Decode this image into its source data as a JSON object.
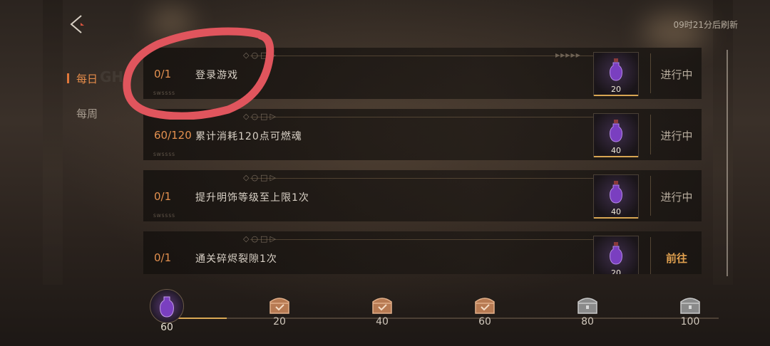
{
  "header": {
    "refresh_text": "09时21分后刷新"
  },
  "tabs": [
    {
      "label": "每日",
      "active": true
    },
    {
      "label": "每周",
      "active": false
    }
  ],
  "tasks": [
    {
      "progress": "0/1",
      "name": "登录游戏",
      "reward": "20",
      "status": "进行中"
    },
    {
      "progress": "60/120",
      "name": "累计消耗120点可燃魂",
      "reward": "40",
      "status": "进行中"
    },
    {
      "progress": "0/1",
      "name": "提升明饰等级至上限1次",
      "reward": "40",
      "status": "进行中"
    },
    {
      "progress": "0/1",
      "name": "通关碎烬裂隙1次",
      "reward": "20",
      "status": "前往"
    }
  ],
  "activity": {
    "current": "60",
    "milestones": [
      {
        "value": "20",
        "state": "claimed"
      },
      {
        "value": "40",
        "state": "claimed"
      },
      {
        "value": "60",
        "state": "claimed"
      },
      {
        "value": "80",
        "state": "locked"
      },
      {
        "value": "100",
        "state": "locked"
      }
    ]
  },
  "colors": {
    "accent": "#e58c4a",
    "highlight_circle": "#e0555d",
    "gold": "#d9a855"
  },
  "icons": [
    "back-arrow-icon",
    "potion-bottle-icon",
    "chest-icon"
  ]
}
